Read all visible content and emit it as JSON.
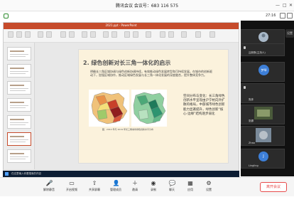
{
  "window": {
    "title": "腾讯会议 会议号：683 116 575"
  },
  "infobar": {
    "time": "27:16"
  },
  "ppt": {
    "title_bar": "2021.ppt - PowerPoint",
    "status": "单击此处添加备注"
  },
  "slide": {
    "title": "2. 绿色创新对长三角一体化的启示",
    "body": "明确长三角区域协调与绿色创新协调持续，有效推动绿色发展转型和可持续发展，在城市的创新驱动下，加强区域协作，推动区域绿色发展与长三角一体化发展的深度融合，提升整体竞争力。",
    "map_caption": "图：2010 年与 2019 年长三角城市绿色创新水平分布",
    "side_text": "空间分布与变化：长三角绿色创新水平呈现由沪宁杭向外扩散的格局，中部城市绿色创新能力显著提升，绿色创新“核心-边缘”结构逐步弱化"
  },
  "taskbar": {
    "search": "在这里输入你要搜索的内容"
  },
  "participants": [
    {
      "name": "汤"
    },
    {
      "name": "吕新默(主持人)"
    },
    {
      "name": "梦琴"
    },
    {
      "name": "张娜"
    },
    {
      "name": "鲁彦"
    },
    {
      "name": "Zhao"
    },
    {
      "name": "Lingling"
    }
  ],
  "side_button": "设置",
  "toolbar": {
    "items": [
      {
        "label": "解除静音",
        "icon": "mic-icon",
        "glyph": "🎤"
      },
      {
        "label": "开启视频",
        "icon": "camera-icon",
        "glyph": "▭"
      },
      {
        "label": "共享屏幕",
        "icon": "share-screen-icon",
        "glyph": "⇧"
      },
      {
        "label": "管理成员",
        "icon": "members-icon",
        "glyph": "👤"
      },
      {
        "label": "邀请",
        "icon": "invite-icon",
        "glyph": "＋"
      },
      {
        "label": "录制",
        "icon": "record-icon",
        "glyph": "◉"
      },
      {
        "label": "聊天",
        "icon": "chat-icon",
        "glyph": "💬"
      },
      {
        "label": "应用",
        "icon": "apps-icon",
        "glyph": "▦"
      },
      {
        "label": "设置",
        "icon": "settings-icon",
        "glyph": "⚙"
      }
    ],
    "leave": "离开会议"
  },
  "colors": {
    "accent": "#c64b2b",
    "leave": "#e84a4a"
  }
}
